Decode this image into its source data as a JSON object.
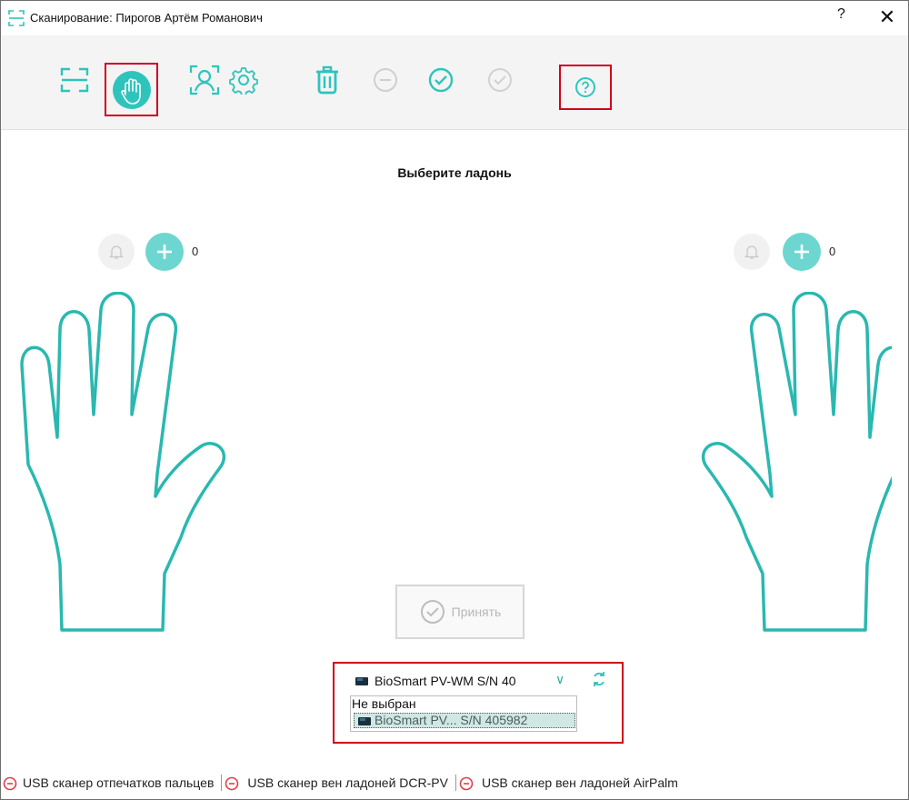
{
  "window": {
    "title": "Сканирование: Пирогов Артём Романович",
    "help_label": "?",
    "close_label": "✕"
  },
  "toolbar": {
    "items": [
      {
        "name": "scan-frame-icon",
        "state": "normal"
      },
      {
        "name": "palm-icon",
        "state": "active"
      },
      {
        "name": "face-scan-icon",
        "state": "normal"
      },
      {
        "name": "settings-icon",
        "state": "normal"
      },
      {
        "name": "trash-icon",
        "state": "normal"
      },
      {
        "name": "minus-circle-icon",
        "state": "disabled"
      },
      {
        "name": "check-circle-icon",
        "state": "normal"
      },
      {
        "name": "check-circle-disabled-icon",
        "state": "disabled"
      },
      {
        "name": "help-circle-icon",
        "state": "normal"
      }
    ]
  },
  "main": {
    "instruction": "Выберите ладонь",
    "left_hand": {
      "count": "0"
    },
    "right_hand": {
      "count": "0"
    },
    "accept_label": "Принять"
  },
  "device": {
    "selected": "BioSmart PV-WM S/N 40",
    "options": [
      "Не выбран",
      "BioSmart PV... S/N 405982"
    ],
    "highlighted_index": 1
  },
  "status": [
    {
      "label": "USB сканер отпечатков пальцев",
      "state": "disconnected"
    },
    {
      "label": "USB сканер вен ладоней DCR-PV",
      "state": "disconnected"
    },
    {
      "label": "USB сканер вен ладоней AirPalm",
      "state": "disconnected"
    }
  ],
  "colors": {
    "accent": "#2ec4bc",
    "accent_light": "#6dd6d0",
    "highlight_border": "#d0021b",
    "error": "#e0404a",
    "disabled": "#c8c8c8"
  }
}
